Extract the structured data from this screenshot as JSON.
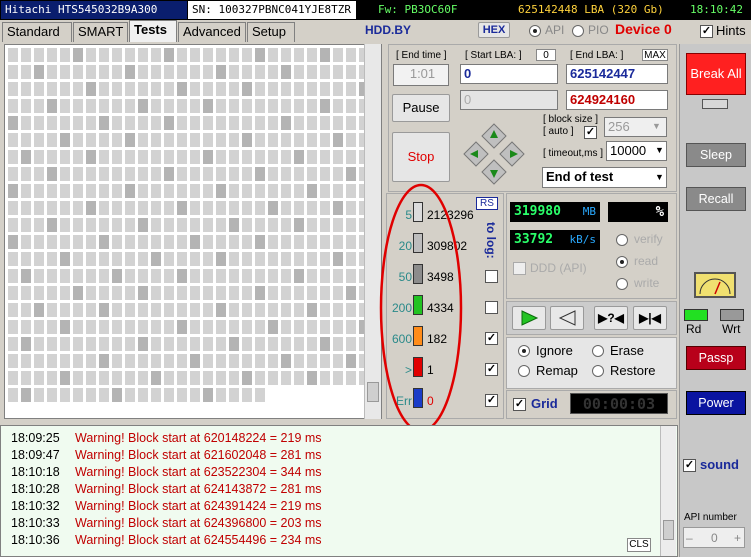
{
  "topbar": {
    "drive": "Hitachi HTS545032B9A300",
    "sn": "SN: 100327PBNC041YJE8TZR",
    "fw": "Fw: PB3OC60F",
    "lba": "625142448 LBA (320 Gb)",
    "time": "18:10:42"
  },
  "tabs": [
    "Standard",
    "SMART",
    "Tests",
    "Advanced",
    "Setup"
  ],
  "hdd_by": "HDD.BY",
  "hex_label": "HEX",
  "api_label": "API",
  "pio_label": "PIO",
  "device_label": "Device 0",
  "hints_label": "Hints",
  "end_time": {
    "label": "[ End time ]",
    "value": "1:01"
  },
  "start_lba": {
    "label": "[ Start LBA: ]",
    "badge": "0",
    "value": "0",
    "value2": "0"
  },
  "end_lba": {
    "label": "[ End LBA: ]",
    "badge": "MAX",
    "value": "625142447",
    "value2": "624924160"
  },
  "pause_label": "Pause",
  "stop_label": "Stop",
  "block_size": {
    "label1": "[ block size ]",
    "label2": "[ auto ]",
    "value": "256"
  },
  "timeout": {
    "label": "[ timeout,ms ]",
    "value": "10000"
  },
  "end_action": "End of test",
  "rs_label": "RS",
  "to_log_label": "to log:",
  "legend": [
    {
      "label": "5",
      "count": "2123296",
      "color": "#dcdcdc",
      "log": false
    },
    {
      "label": "20",
      "count": "309802",
      "color": "#bdbdbd",
      "log": false
    },
    {
      "label": "50",
      "count": "3498",
      "color": "#8c8c8c",
      "log": false
    },
    {
      "label": "200",
      "count": "4334",
      "color": "#22c322",
      "log": false
    },
    {
      "label": "600",
      "count": "182",
      "color": "#ff8c1a",
      "log": true
    },
    {
      "label": ">",
      "count": "1",
      "color": "#e00000",
      "log": true
    },
    {
      "label": "Err",
      "count": "0",
      "color": "#1a3cc8",
      "log": true
    }
  ],
  "stats": {
    "mb": "319980",
    "mb_unit": "MB",
    "percent": "%",
    "speed": "33792",
    "speed_unit": "kB/s"
  },
  "modes": {
    "verify": "verify",
    "read": "read",
    "write": "write",
    "ddd": "DDD (API)"
  },
  "error_handling": {
    "ignore": "Ignore",
    "erase": "Erase",
    "remap": "Remap",
    "restore": "Restore"
  },
  "grid_label": "Grid",
  "timer": "00:00:03",
  "side": {
    "break_all": "Break All",
    "sleep": "Sleep",
    "recall": "Recall",
    "rd": "Rd",
    "wrt": "Wrt",
    "passp": "Passp",
    "power": "Power",
    "sound": "sound",
    "api_number_label": "API number",
    "api_number": "0"
  },
  "log": [
    {
      "time": "18:09:25",
      "msg": "Warning! Block start at 620148224 = 219 ms"
    },
    {
      "time": "18:09:47",
      "msg": "Warning! Block start at 621602048 = 281 ms"
    },
    {
      "time": "18:10:18",
      "msg": "Warning! Block start at 623522304 = 344 ms"
    },
    {
      "time": "18:10:28",
      "msg": "Warning! Block start at 624143872 = 281 ms"
    },
    {
      "time": "18:10:32",
      "msg": "Warning! Block start at 624391424 = 219 ms"
    },
    {
      "time": "18:10:33",
      "msg": "Warning! Block start at 624396800 = 203 ms"
    },
    {
      "time": "18:10:36",
      "msg": "Warning! Block start at 624554496 = 234 ms"
    }
  ],
  "cls_label": "CLS"
}
